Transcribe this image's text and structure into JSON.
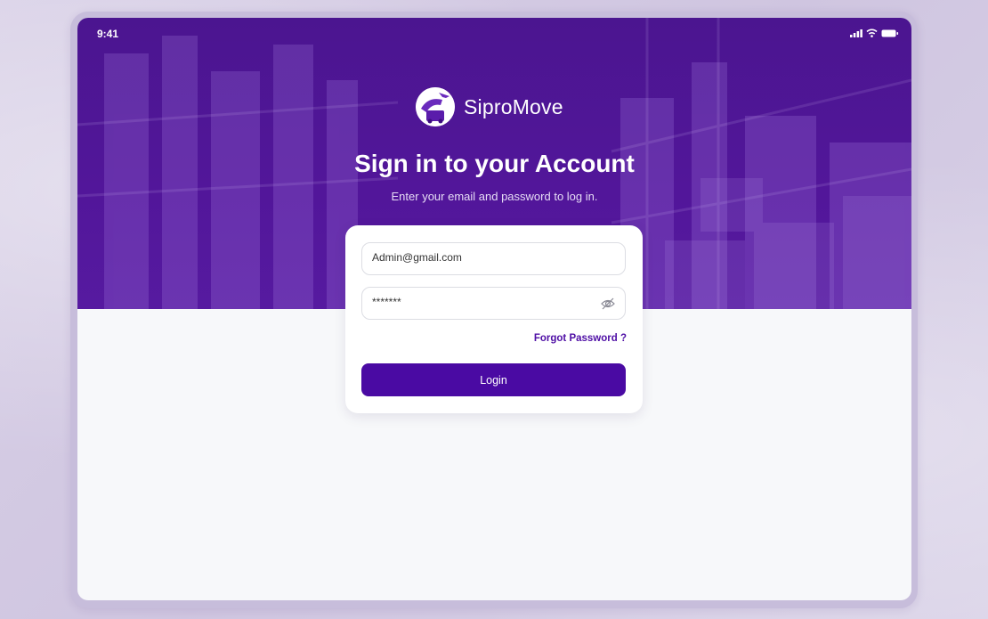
{
  "status_bar": {
    "time": "9:41"
  },
  "brand": {
    "name": "SiproMove"
  },
  "header": {
    "title": "Sign in to your Account",
    "subtitle": "Enter your email and password to log in."
  },
  "form": {
    "email_value": "Admin@gmail.com",
    "password_value": "*******",
    "forgot_label": "Forgot Password ?",
    "login_label": "Login"
  },
  "colors": {
    "primary": "#4a0aa3",
    "hero": "#52169a",
    "background": "#d8d0e6",
    "screen": "#f7f8fa"
  },
  "icons": [
    "signal-icon",
    "wifi-icon",
    "battery-icon",
    "eye-off-icon",
    "logo-icon"
  ]
}
